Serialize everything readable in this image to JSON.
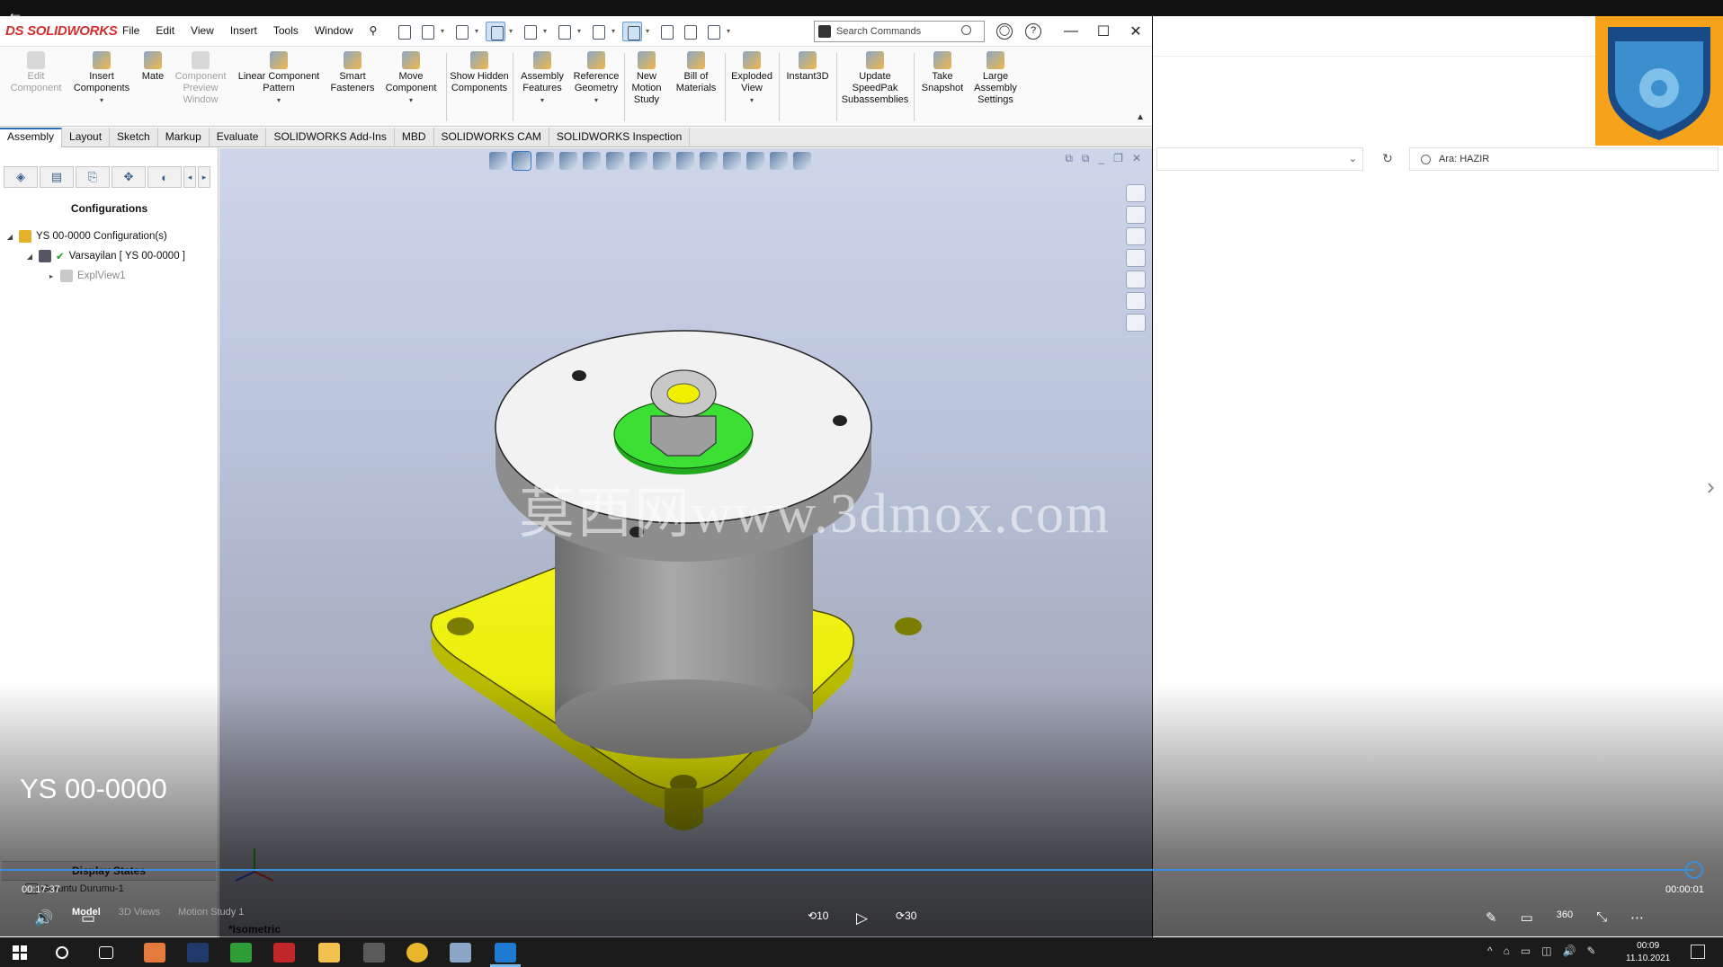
{
  "player": {
    "back_label": "←",
    "video_title": "YS 00-0000",
    "elapsed": "00:17:37",
    "remaining": "00:00:01",
    "progress_fraction": 1.0,
    "skip_back_label": "10",
    "skip_fwd_label": "30",
    "play_glyph": "▷",
    "volume_glyph": "🔊",
    "cc_glyph": "▭",
    "right_icons": [
      "✎",
      "▭",
      "360",
      "⤡",
      "⋯"
    ]
  },
  "app": {
    "logo": "DS SOLIDWORKS",
    "menu": [
      "File",
      "Edit",
      "View",
      "Insert",
      "Tools",
      "Window"
    ],
    "search_placeholder": "Search Commands",
    "search_icon": "search-icon",
    "window_controls": [
      "—",
      "☐",
      "✕"
    ],
    "help_glyphs": [
      "◯",
      "?"
    ]
  },
  "ribbon": {
    "tools": [
      {
        "label": "Edit Component",
        "disabled": true
      },
      {
        "label": "Insert Components",
        "has_dropdown": true
      },
      {
        "label": "Mate"
      },
      {
        "label": "Component Preview Window",
        "disabled": true
      },
      {
        "label": "Linear Component Pattern",
        "has_dropdown": true
      },
      {
        "label": "Smart Fasteners"
      },
      {
        "label": "Move Component",
        "has_dropdown": true
      },
      {
        "label": "Show Hidden Components"
      },
      {
        "label": "Assembly Features",
        "has_dropdown": true
      },
      {
        "label": "Reference Geometry",
        "has_dropdown": true
      },
      {
        "label": "New Motion Study"
      },
      {
        "label": "Bill of Materials"
      },
      {
        "label": "Exploded View",
        "has_dropdown": true
      },
      {
        "label": "Instant3D"
      },
      {
        "label": "Update SpeedPak Subassemblies"
      },
      {
        "label": "Take Snapshot"
      },
      {
        "label": "Large Assembly Settings"
      }
    ]
  },
  "tabs": [
    "Assembly",
    "Layout",
    "Sketch",
    "Markup",
    "Evaluate",
    "SOLIDWORKS Add-Ins",
    "MBD",
    "SOLIDWORKS CAM",
    "SOLIDWORKS Inspection"
  ],
  "active_tab": "Assembly",
  "feature_manager": {
    "title": "Configurations",
    "tree": [
      {
        "label": "YS 00-0000 Configuration(s)",
        "expanded": true,
        "icon": "config-root-icon"
      },
      {
        "label": "Varsayilan [ YS 00-0000 ]",
        "expanded": true,
        "icon": "configuration-icon",
        "checked": true
      },
      {
        "label": "ExplView1",
        "expanded": false,
        "icon": "exploded-view-icon",
        "muted": true
      }
    ],
    "display_states_title": "Display States",
    "display_state": "Goruntu Durumu-1"
  },
  "graphics": {
    "view_label": "*Isometric",
    "watermark": "莫西网www.3dmox.com"
  },
  "bottom_tabs": [
    "Model",
    "3D Views",
    "Motion Study 1"
  ],
  "active_bottom_tab": "Model",
  "right_pane": {
    "search_placeholder": "Ara: HAZIR",
    "refresh_glyph": "↻",
    "dropdown_glyph": "⌄",
    "next_glyph": "›"
  },
  "taskbar": {
    "time": "00:09",
    "date": "11.10.2021",
    "apps": [
      "search-icon",
      "task-view-icon",
      "app-icon",
      "photoshop-icon",
      "camtasia-icon",
      "solidworks-icon",
      "file-explorer-icon",
      "calculator-icon",
      "chrome-icon",
      "app-icon-2",
      "video-player-icon"
    ],
    "tray": [
      "^",
      "⌂",
      "▭",
      "◫",
      "🔊",
      "✎"
    ]
  },
  "colors": {
    "base_yellow": "#e3e600",
    "cylinder_gray": "#8c8c8c",
    "plate_white": "#f2f2f2",
    "washer_green": "#34d22e",
    "accent_blue": "#3a8fd8",
    "solidworks_red": "#d32f2f",
    "badge_orange": "#f7a21b"
  }
}
